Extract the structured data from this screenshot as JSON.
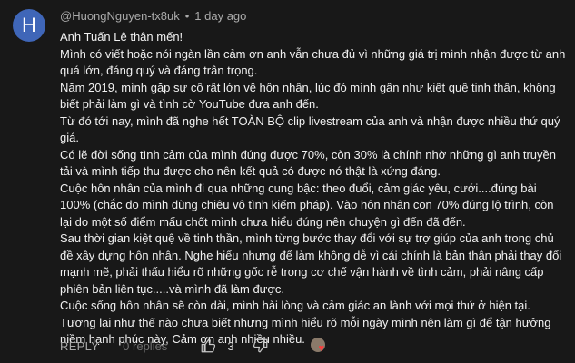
{
  "comment": {
    "avatar_letter": "H",
    "avatar_color": "#3f66b8",
    "author": "@HuongNguyen-tx8uk",
    "separator": "•",
    "time": "1 day ago",
    "paragraphs": [
      "Anh Tuấn Lê thân mến!",
      "Mình có viết hoặc nói ngàn lần cảm ơn anh vẫn chưa đủ vì những giá trị mình nhận được từ anh quá lớn, đáng quý và đáng trân trọng.",
      "Năm 2019, mình gặp sự cố rất lớn về hôn nhân, lúc đó mình gần như kiệt quệ tinh thần, không biết phải làm gì và tình cờ YouTube đưa anh đến.",
      "Từ đó tới nay, mình đã nghe hết TOÀN BỘ clip livestream của anh và nhận được nhiều thứ quý giá.",
      "Có lẽ đời sống tình cảm của mình đúng được 70%, còn 30% là chính nhờ những gì anh truyền tải và mình tiếp thu được cho nên kết quả có được nó thật là xứng đáng.",
      "Cuộc hôn nhân của mình đi qua những cung bậc: theo đuổi, cảm giác yêu, cưới....đúng bài 100% (chắc do mình dùng chiêu vô tình kiếm pháp). Vào hôn nhân con 70% đúng lộ trình, còn lại do một số điểm mấu chốt mình chưa hiểu đúng nên chuyện gì đến đã đến.",
      "Sau thời gian kiệt quệ về tinh thần, mình từng bước thay đổi với sự trợ giúp của anh trong chủ đề xây dựng hôn nhân. Nghe hiểu nhưng để làm không dễ vì cái chính là bản thân phải thay đổi mạnh mẽ, phải thấu hiểu rõ những gốc rễ trong cơ chế vận hành về tình cảm, phải nâng cấp phiên bản liên tục.....và mình đã làm được.",
      "Cuộc sống hôn nhân sẽ còn dài, mình hài lòng và cảm giác an lành với mọi thứ ở hiện tại. Tương lai như thế nào chưa biết nhưng mình hiểu rõ mỗi ngày mình nên làm gì để tận hưởng niềm hạnh phúc này, Cảm ơn anh nhiều nhiều."
    ]
  },
  "actions": {
    "reply_label": "REPLY",
    "replies_label": "0 replies",
    "like_count": "3",
    "like_icon": "thumb-up-icon",
    "dislike_icon": "thumb-down-icon",
    "heart_icon": "heart-icon",
    "heart_char": "♥",
    "heart_color": "#ff3b3b"
  }
}
